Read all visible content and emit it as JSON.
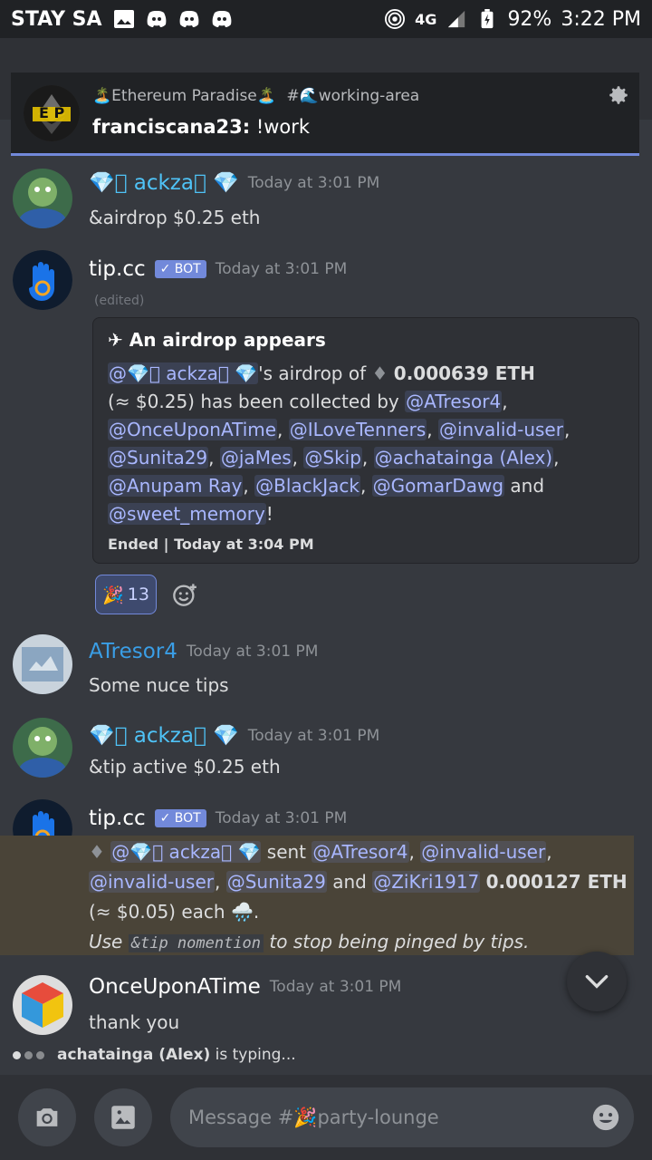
{
  "status_bar": {
    "carrier": "STAY SA",
    "network": "4G",
    "battery": "92%",
    "time": "3:22 PM"
  },
  "notification": {
    "server": "🏝️Ethereum Paradise🏝️",
    "channel": "#🌊working-area",
    "author": "franciscana23:",
    "text": "!work",
    "avatar_text": "E P"
  },
  "messages": [
    {
      "author": "💎⃟ ackza⃟ 💎",
      "time": "Today at 3:01 PM",
      "text": "&airdrop $0.25 eth"
    },
    {
      "author": "tip.cc",
      "bot_tag": "✓ BOT",
      "time": "Today at 3:01 PM",
      "edited": "(edited)",
      "embed": {
        "title": "✈ An airdrop appears",
        "mention_author": "@💎⃟ ackza⃟ 💎",
        "text_1": "'s airdrop of",
        "amount": "0.000639 ETH",
        "text_2": "(≈ $0.25) has been collected by",
        "mentions": [
          "@ATresor4",
          "@OnceUponATime",
          "@ILoveTenners",
          "@invalid-user",
          "@Sunita29",
          "@jaMes",
          "@Skip",
          "@achatainga (Alex)",
          "@Anupam Ray",
          "@BlackJack",
          "@GomarDawg",
          "@sweet_memory"
        ],
        "and": "and",
        "end": "!",
        "footer": "Ended | Today at 3:04 PM"
      },
      "reaction_count": "13"
    },
    {
      "author": "ATresor4",
      "time": "Today at 3:01 PM",
      "text": "Some nuce tips"
    },
    {
      "author": "💎⃟ ackza⃟ 💎",
      "time": "Today at 3:01 PM",
      "text": "&tip active $0.25 eth"
    },
    {
      "author": "tip.cc",
      "bot_tag": "✓ BOT",
      "time": "Today at 3:01 PM",
      "mention_author": "@💎⃟ ackza⃟ 💎",
      "sent": "sent",
      "mentions": [
        "@ATresor4",
        "@invalid-user",
        "@invalid-user",
        "@Sunita29",
        "@ZiKri1917"
      ],
      "and": "and",
      "amount": "0.000127 ETH",
      "tail": "(≈",
      "tail_2": "$0.05) each",
      "use_pre": "Use",
      "code": "&tip nomention",
      "use_post": "to stop being pinged by tips."
    },
    {
      "author": "OnceUponATime",
      "time": "Today at 3:01 PM",
      "text": "thank you"
    }
  ],
  "typing": {
    "user": "achatainga (Alex)",
    "suffix": "is typing..."
  },
  "composer": {
    "placeholder": "Message #🎉party-lounge"
  },
  "colors": {
    "background": "#36393f",
    "accent": "#7289da",
    "mention": "#a9b7ff",
    "highlight": "#4a4438"
  }
}
